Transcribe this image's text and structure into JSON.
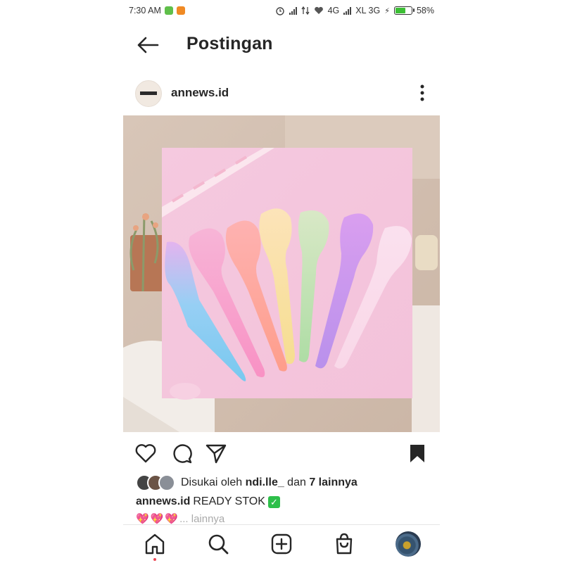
{
  "status_bar": {
    "time": "7:30 AM",
    "network1": "4G",
    "carrier2": "XL 3G",
    "battery": "58%",
    "battery_level": 0.58
  },
  "header": {
    "title": "Postingan",
    "back_icon": "arrow-left-icon"
  },
  "post": {
    "username": "annews.id",
    "image_description_icon": "spatula-photo",
    "actions": [
      "heart-icon",
      "comment-icon",
      "share-icon",
      "bookmark-icon"
    ]
  },
  "likes": {
    "prefix": "Disukai oleh ",
    "user": "ndi.lle_",
    "middle": " dan ",
    "others": "7 lainnya"
  },
  "caption": {
    "username": "annews.id",
    "text": "READY STOK",
    "more": "... lainnya"
  },
  "colors": {
    "accent_like": "#ed4956",
    "text": "#262626"
  },
  "nav": [
    "home-icon",
    "search-icon",
    "add-post-icon",
    "shop-icon",
    "profile-avatar"
  ]
}
